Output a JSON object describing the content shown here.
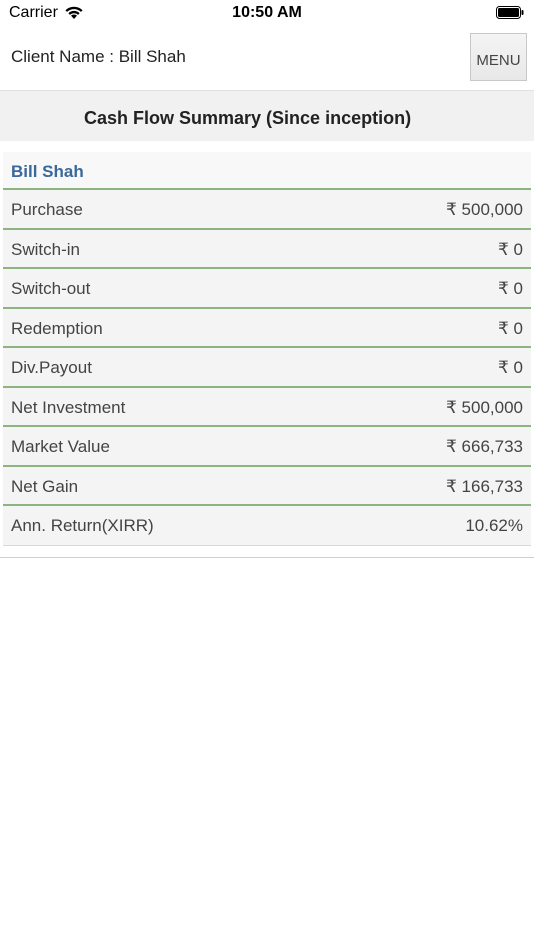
{
  "status_bar": {
    "carrier": "Carrier",
    "time": "10:50 AM"
  },
  "header": {
    "client_name": "Client Name : Bill Shah",
    "menu_label": "MENU"
  },
  "page": {
    "title": "Cash Flow Summary (Since inception)"
  },
  "summary": {
    "name": "Bill Shah",
    "rows": [
      {
        "label": "Purchase",
        "value": "₹ 500,000"
      },
      {
        "label": "Switch-in",
        "value": "₹ 0"
      },
      {
        "label": "Switch-out",
        "value": "₹ 0"
      },
      {
        "label": "Redemption",
        "value": "₹ 0"
      },
      {
        "label": "Div.Payout",
        "value": "₹ 0"
      },
      {
        "label": "Net Investment",
        "value": "₹ 500,000"
      },
      {
        "label": "Market Value",
        "value": "₹ 666,733"
      },
      {
        "label": "Net Gain",
        "value": "₹ 166,733"
      },
      {
        "label": "Ann. Return(XIRR)",
        "value": "10.62%"
      }
    ]
  },
  "colors": {
    "accent_name": "#3a6899",
    "row_divider": "#8db380"
  },
  "icons": {
    "wifi": "wifi-icon",
    "battery": "battery-icon"
  }
}
